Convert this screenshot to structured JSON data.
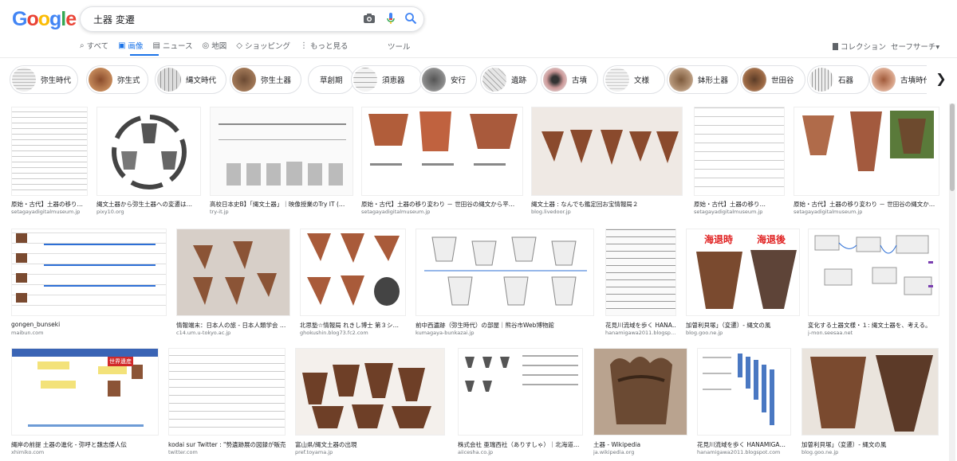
{
  "logo": {
    "letters": [
      "G",
      "o",
      "o",
      "g",
      "l",
      "e"
    ],
    "colors": [
      "#4285f4",
      "#ea4335",
      "#fbbc05",
      "#4285f4",
      "#34a853",
      "#ea4335"
    ]
  },
  "search": {
    "query": "土器 変遷",
    "camera_icon": "camera-icon",
    "mic_icon": "mic-icon",
    "search_icon": "search-icon"
  },
  "tabs": [
    {
      "icon": "⌕",
      "label": "すべて"
    },
    {
      "icon": "▣",
      "label": "画像"
    },
    {
      "icon": "▤",
      "label": "ニュース"
    },
    {
      "icon": "◎",
      "label": "地図"
    },
    {
      "icon": "◇",
      "label": "ショッピング"
    },
    {
      "icon": "⋮",
      "label": "もっと見る"
    }
  ],
  "tools_label": "ツール",
  "collection_label": "コレクション",
  "safesearch_label": "セーフサーチ▾",
  "accent": "#1a73e8",
  "chips": [
    "弥生時代",
    "弥生式",
    "縄文時代",
    "弥生土器",
    "草創期",
    "須恵器",
    "安行",
    "遺跡",
    "古墳",
    "文様",
    "鉢形土器",
    "世田谷",
    "石器",
    "古墳時代"
  ],
  "results": [
    {
      "title": "原始・古代】土器の移り…",
      "source": "setagayadigitalmuseum.jp"
    },
    {
      "title": "縄文土器から弥生土器への変遷は…",
      "source": "pixy10.org"
    },
    {
      "title": "高校日本史B】「縄文土器」｜映像授業のTry IT (…",
      "source": "try-it.jp"
    },
    {
      "title": "原始・古代】土器の移り変わり － 世田谷の縄文から平…",
      "source": "setagayadigitalmuseum.jp"
    },
    {
      "title": "縄文土器 : なんでも鑑定回お宝情報局２",
      "source": "blog.livedoor.jp"
    },
    {
      "title": "原始・古代】土器の移り…",
      "source": "setagayadigitalmuseum.jp"
    },
    {
      "title": "原始・古代】土器の移り変わり － 世田谷の縄文か…",
      "source": "setagayadigitalmuseum.jp"
    },
    {
      "title": "gongen_bunseki",
      "source": "maibun.com"
    },
    {
      "title": "情報端末：日本人の旅 - 日本人類学会 …",
      "source": "c14.um.u-tokyo.ac.jp"
    },
    {
      "title": "北思塾☆情報局 れきし博士 第３シ…",
      "source": "ghokushin.blog73.fc2.com"
    },
    {
      "title": "前中西遺跡（弥生時代）の部屋｜熊谷市Web博物館",
      "source": "kumagaya-bunkazai.jp"
    },
    {
      "title": "花見川流域を歩く HANA…",
      "source": "hanamigawa2011.blogsp…"
    },
    {
      "title": "加曽利貝塚」（変遷）- 縄文の風",
      "source": "blog.goo.ne.jp"
    },
    {
      "title": "変化する土器文様・１: 縄文土器を、考える。",
      "source": "j-mon.seesaa.net"
    },
    {
      "title": "縄岸の前提 土器の進化 - 弥呼と魏志倭人伝",
      "source": "xhimiko.com"
    },
    {
      "title": "kodai sur Twitter : \"勢遺跡展の図録が販売…",
      "source": "twitter.com"
    },
    {
      "title": "富山県/縄文土器の出現",
      "source": "pref.toyama.jp"
    },
    {
      "title": "株式会社 亜瑞西社（ありすしゃ）｜北海道…",
      "source": "aiicesha.co.jp"
    },
    {
      "title": "土器 - Wikipedia",
      "source": "ja.wikipedia.org"
    },
    {
      "title": "花見川流域を歩く HANAMIGA…",
      "source": "hanamigawa2011.blogspot.com"
    },
    {
      "title": "加曽利貝塚」（変遷）- 縄文の風",
      "source": "blog.goo.ne.jp"
    }
  ],
  "overlay_texts": {
    "sea_rise": "海退時",
    "sea_after": "海退後",
    "world_heritage": "世界遺産"
  }
}
